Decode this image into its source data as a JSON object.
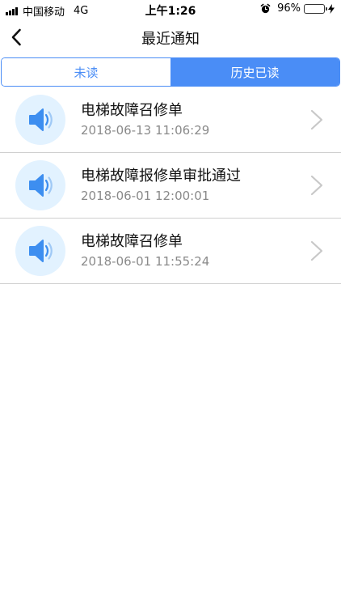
{
  "status_bar": {
    "carrier": "中国移动",
    "network": "4G",
    "time": "上午1:26",
    "battery_percent": "96%",
    "alarm_icon": "alarm-icon",
    "charging_icon": "bolt-icon",
    "battery_color": "#4cd964"
  },
  "nav": {
    "title": "最近通知",
    "back_icon": "chevron-left-icon"
  },
  "tabs": [
    {
      "label": "未读",
      "selected": false
    },
    {
      "label": "历史已读",
      "selected": true
    }
  ],
  "accent_color": "#4a8df6",
  "notifications": [
    {
      "title": "电梯故障召修单",
      "time": "2018-06-13 11:06:29",
      "icon": "speaker-icon"
    },
    {
      "title": "电梯故障报修单审批通过",
      "time": "2018-06-01 12:00:01",
      "icon": "speaker-icon"
    },
    {
      "title": "电梯故障召修单",
      "time": "2018-06-01 11:55:24",
      "icon": "speaker-icon"
    }
  ]
}
